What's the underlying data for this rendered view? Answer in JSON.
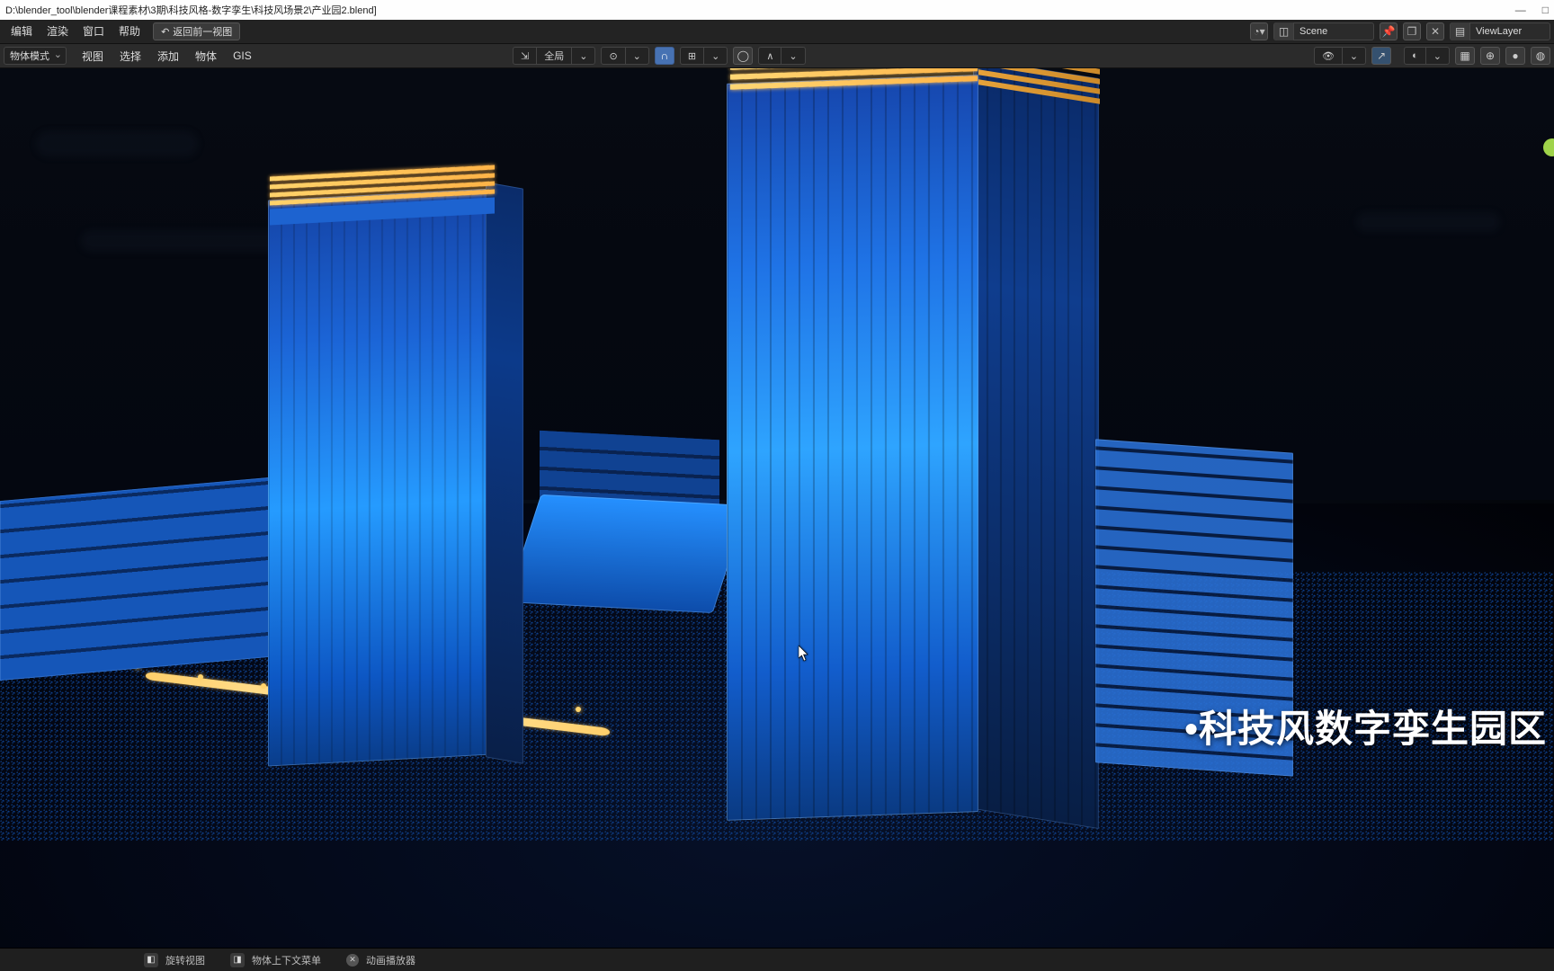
{
  "titlebar": {
    "path": "D:\\blender_tool\\blender课程素材\\3期\\科技风格-数字孪生\\科技风场景2\\产业园2.blend]",
    "minimize": "—",
    "maximize": "□"
  },
  "menu": {
    "edit": "编辑",
    "render": "渲染",
    "window": "窗口",
    "help": "帮助",
    "back": "返回前一视图"
  },
  "header_right": {
    "scene_label": "Scene",
    "viewlayer_label": "ViewLayer"
  },
  "toolbar": {
    "mode": "物体模式",
    "view": "视图",
    "select": "选择",
    "add": "添加",
    "object": "物体",
    "gis": "GIS",
    "orientation": "全局"
  },
  "overlay": {
    "title": "•科技风数字孪生园区"
  },
  "statusbar": {
    "rotate": "旋转视图",
    "context_menu": "物体上下文菜单",
    "player": "动画播放器"
  }
}
